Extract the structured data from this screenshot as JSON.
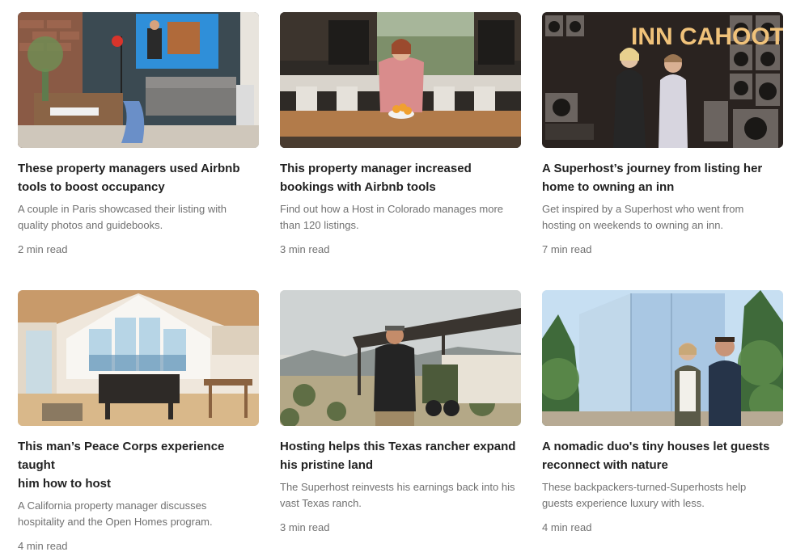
{
  "articles": [
    {
      "title_lines": [
        "These property managers used Airbnb",
        "tools to boost occupancy"
      ],
      "desc_lines": [
        "A couple in Paris showcased their listing with",
        "quality photos and guidebooks."
      ],
      "read_time": "2 min read",
      "image": "living-room-photo"
    },
    {
      "title_lines": [
        "This property manager increased",
        "bookings with Airbnb tools"
      ],
      "desc_lines": [
        "Find out how a Host in Colorado manages more",
        "than 120 listings."
      ],
      "read_time": "3 min read",
      "image": "kitchen-photo"
    },
    {
      "title_lines": [
        "A Superhost’s journey from listing her",
        "home to owning an inn"
      ],
      "desc_lines": [
        "Get inspired by a Superhost who went from",
        "hosting on weekends to owning an inn."
      ],
      "read_time": "7 min read",
      "image": "inn-cahoots-photo",
      "image_text": "INN CAHOOTS"
    },
    {
      "title_lines": [
        "This man’s Peace Corps experience taught",
        "him how to host"
      ],
      "desc_lines": [
        "A California property manager discusses",
        "hospitality and the Open Homes program."
      ],
      "read_time": "4 min read",
      "image": "cabin-interior-photo"
    },
    {
      "title_lines": [
        "Hosting helps this Texas rancher expand",
        "his pristine land"
      ],
      "desc_lines": [
        "The Superhost reinvests his earnings back into his",
        "vast Texas ranch."
      ],
      "read_time": "3 min read",
      "image": "texas-ranch-photo"
    },
    {
      "title_lines": [
        "A nomadic duo's tiny houses let guests",
        "reconnect with nature"
      ],
      "desc_lines": [
        "These backpackers-turned-Superhosts help",
        "guests experience luxury with less."
      ],
      "read_time": "4 min read",
      "image": "tiny-house-forest-photo"
    }
  ]
}
